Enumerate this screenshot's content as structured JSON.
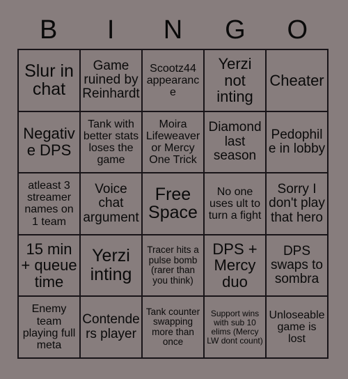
{
  "card": {
    "title": "BINGO",
    "header_letters": [
      "B",
      "I",
      "N",
      "G",
      "O"
    ],
    "background_color": "#877d7d",
    "cell_color": "#877d7d",
    "border_color": "#181418",
    "text_color": "#0a0a0a",
    "columns": 5,
    "rows": 5,
    "free_space_index": 12,
    "cells": [
      {
        "text": "Slur in chat",
        "size": "xxl"
      },
      {
        "text": "Game ruined by Reinhardt",
        "size": "lg"
      },
      {
        "text": "Scootz44 appearance",
        "size": "md"
      },
      {
        "text": "Yerzi not inting",
        "size": "xl"
      },
      {
        "text": "Cheater",
        "size": "xl"
      },
      {
        "text": "Negative DPS",
        "size": "xl"
      },
      {
        "text": "Tank with better stats loses the game",
        "size": "md"
      },
      {
        "text": "Moira Lifeweaver or Mercy One Trick",
        "size": "md"
      },
      {
        "text": "Diamond last season",
        "size": "lg"
      },
      {
        "text": "Pedophile in lobby",
        "size": "lg"
      },
      {
        "text": "atleast 3 streamer names on 1 team",
        "size": "md"
      },
      {
        "text": "Voice chat argument",
        "size": "lg"
      },
      {
        "text": "Free Space",
        "size": "xxl"
      },
      {
        "text": "No one uses ult to turn a fight",
        "size": "md"
      },
      {
        "text": "Sorry I don't play that hero",
        "size": "lg"
      },
      {
        "text": "15 min + queue time",
        "size": "xl"
      },
      {
        "text": "Yerzi inting",
        "size": "xxl"
      },
      {
        "text": "Tracer hits a pulse bomb (rarer than you think)",
        "size": "sm"
      },
      {
        "text": "DPS + Mercy duo",
        "size": "xl"
      },
      {
        "text": "DPS swaps to sombra",
        "size": "lg"
      },
      {
        "text": "Enemy team playing full meta",
        "size": "md"
      },
      {
        "text": "Contenders player",
        "size": "lg"
      },
      {
        "text": "Tank counter swapping more than once",
        "size": "sm"
      },
      {
        "text": "Support wins with sub 10 elims (Mercy LW dont count)",
        "size": "xs"
      },
      {
        "text": "Unloseable game is lost",
        "size": "md"
      }
    ]
  }
}
